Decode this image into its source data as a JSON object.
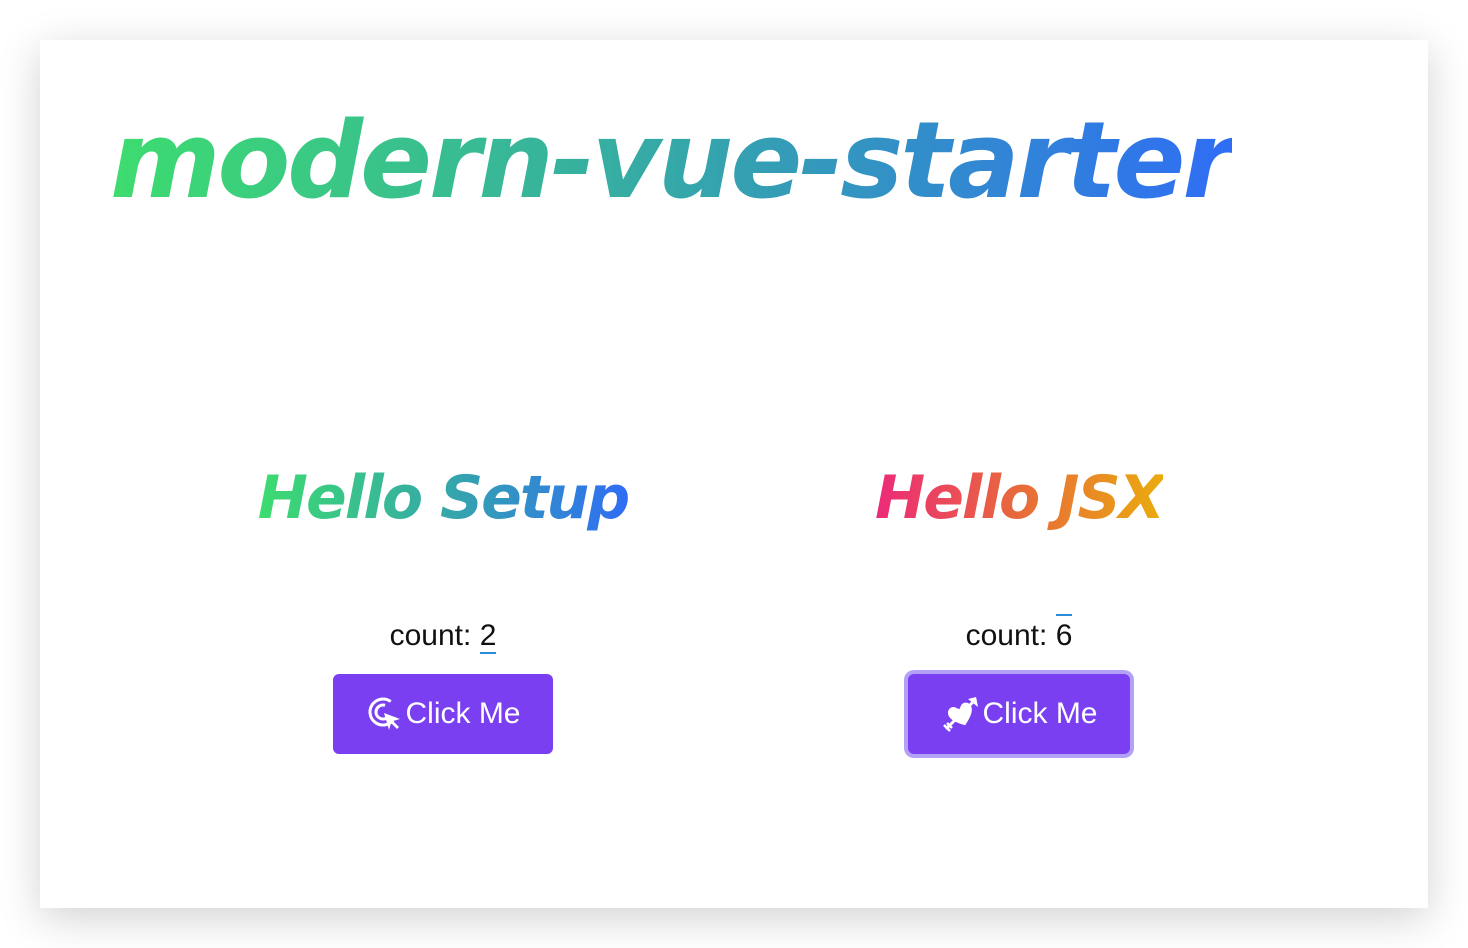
{
  "app": {
    "title": "modern-vue-starter"
  },
  "panels": [
    {
      "heading_a": "Hello",
      "heading_b": "Setup",
      "count_label": "count:",
      "count_value": "2",
      "button_label": "Click Me",
      "button_icon": "target-pointer-icon"
    },
    {
      "heading_a": "Hello",
      "heading_b": "JSX",
      "count_label": "count:",
      "count_value": "6",
      "button_label": "Click Me",
      "button_icon": "heart-arrow-icon"
    }
  ],
  "colors": {
    "button_bg": "#7b3ff2",
    "focus_ring": "#b3a0f7",
    "gradient_green_blue": [
      "#3ddc6f",
      "#2f6df5"
    ],
    "gradient_pink_yellow": [
      "#ec2a7a",
      "#eaab0e"
    ]
  }
}
